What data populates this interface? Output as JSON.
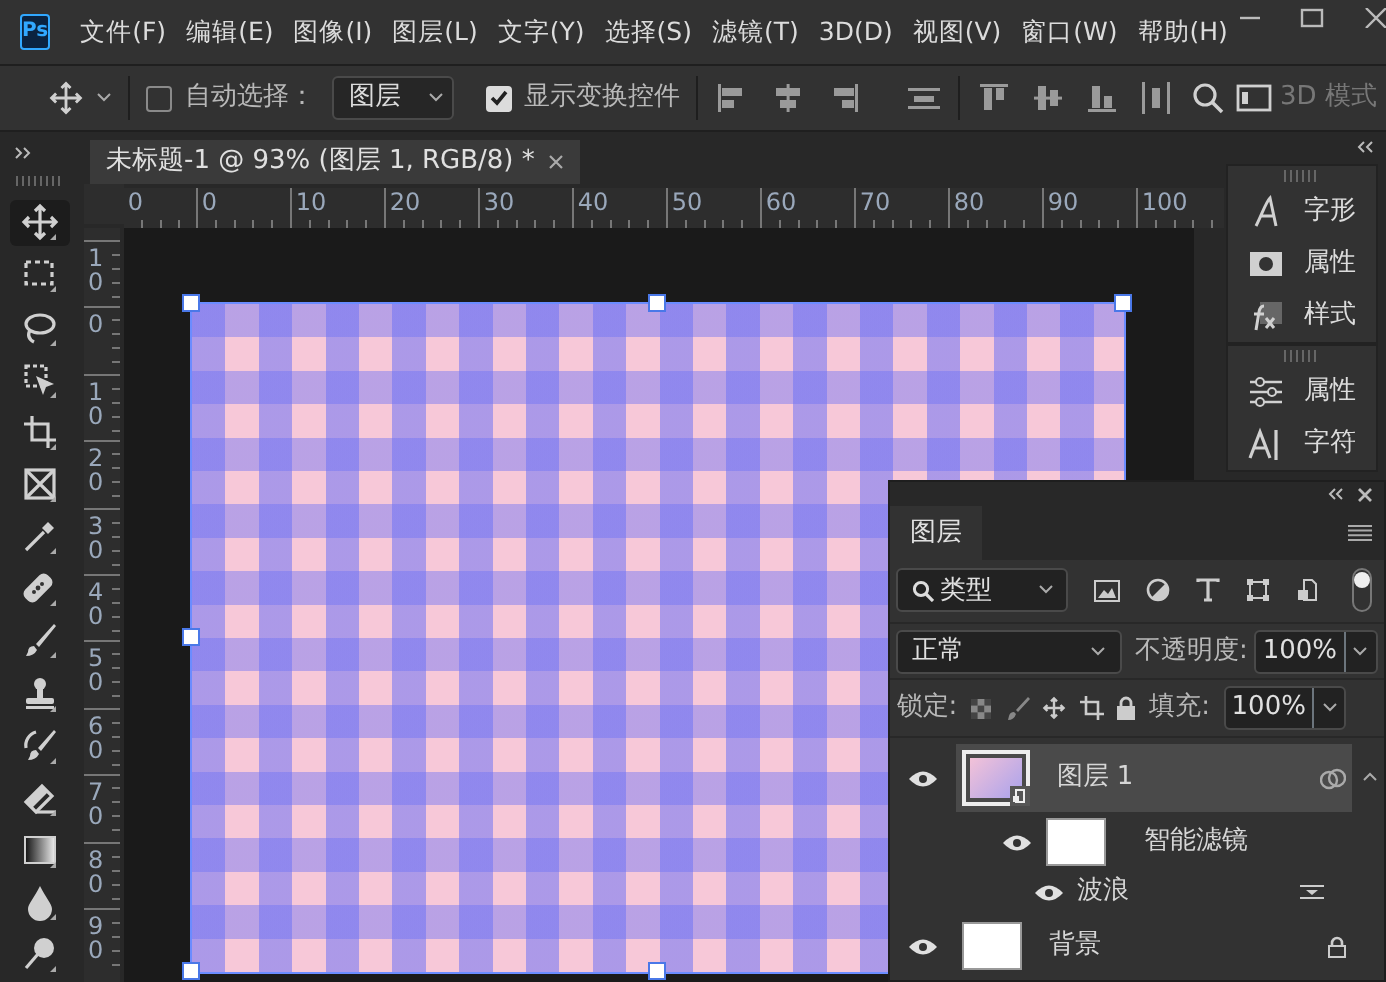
{
  "app_logo": "Ps",
  "menu": [
    "文件(F)",
    "编辑(E)",
    "图像(I)",
    "图层(L)",
    "文字(Y)",
    "选择(S)",
    "滤镜(T)",
    "3D(D)",
    "视图(V)",
    "窗口(W)",
    "帮助(H)"
  ],
  "options_bar": {
    "auto_select": {
      "label": "自动选择：",
      "checked": false
    },
    "target": {
      "value": "图层"
    },
    "show_transform": {
      "label": "显示变换控件",
      "checked": true
    },
    "mode_3d": "3D 模式"
  },
  "document_tab": {
    "title": "未标题-1 @ 93% (图层 1, RGB/8) *"
  },
  "tools": [
    {
      "kind": "move",
      "selected": true
    },
    {
      "kind": "marquee",
      "selected": false
    },
    {
      "kind": "lasso",
      "selected": false
    },
    {
      "kind": "object_select",
      "selected": false
    },
    {
      "kind": "crop",
      "selected": false
    },
    {
      "kind": "frame",
      "selected": false
    },
    {
      "kind": "eyedropper",
      "selected": false
    },
    {
      "kind": "healing",
      "selected": false
    },
    {
      "kind": "brush",
      "selected": false
    },
    {
      "kind": "stamp",
      "selected": false
    },
    {
      "kind": "history_brush",
      "selected": false
    },
    {
      "kind": "eraser",
      "selected": false
    },
    {
      "kind": "gradient",
      "selected": false
    },
    {
      "kind": "blur",
      "selected": false
    },
    {
      "kind": "dodge",
      "selected": false
    }
  ],
  "rulers": {
    "horizontal": [
      "0",
      "0",
      "10",
      "20",
      "30",
      "40",
      "50",
      "60",
      "70",
      "80",
      "90",
      "100"
    ],
    "vertical": [
      "10",
      "0",
      "10",
      "20",
      "30",
      "40",
      "50",
      "60",
      "70",
      "80",
      "90"
    ]
  },
  "dock_groups": [
    [
      {
        "kind": "glyphs",
        "label": "字形"
      },
      {
        "kind": "properties",
        "label": "属性"
      },
      {
        "kind": "styles",
        "label": "样式"
      }
    ],
    [
      {
        "kind": "adjust",
        "label": "属性"
      },
      {
        "kind": "character",
        "label": "字符"
      }
    ]
  ],
  "layers_panel": {
    "tab": "图层",
    "filter": "类型",
    "filter_on": true,
    "blend_mode": "正常",
    "opacity_label": "不透明度:",
    "opacity": "100%",
    "lock_label": "锁定:",
    "fill_label": "填充:",
    "fill": "100%"
  },
  "layers": [
    {
      "name": "图层 1",
      "kind": "smart",
      "visible": true,
      "selected": true,
      "expanded": true,
      "children": [
        {
          "name": "智能滤镜",
          "kind": "filter_mask",
          "visible": true,
          "children": [
            {
              "name": "波浪",
              "kind": "filter",
              "visible": true
            }
          ]
        }
      ]
    },
    {
      "name": "背景",
      "kind": "background",
      "visible": true,
      "selected": false,
      "locked": true
    }
  ]
}
